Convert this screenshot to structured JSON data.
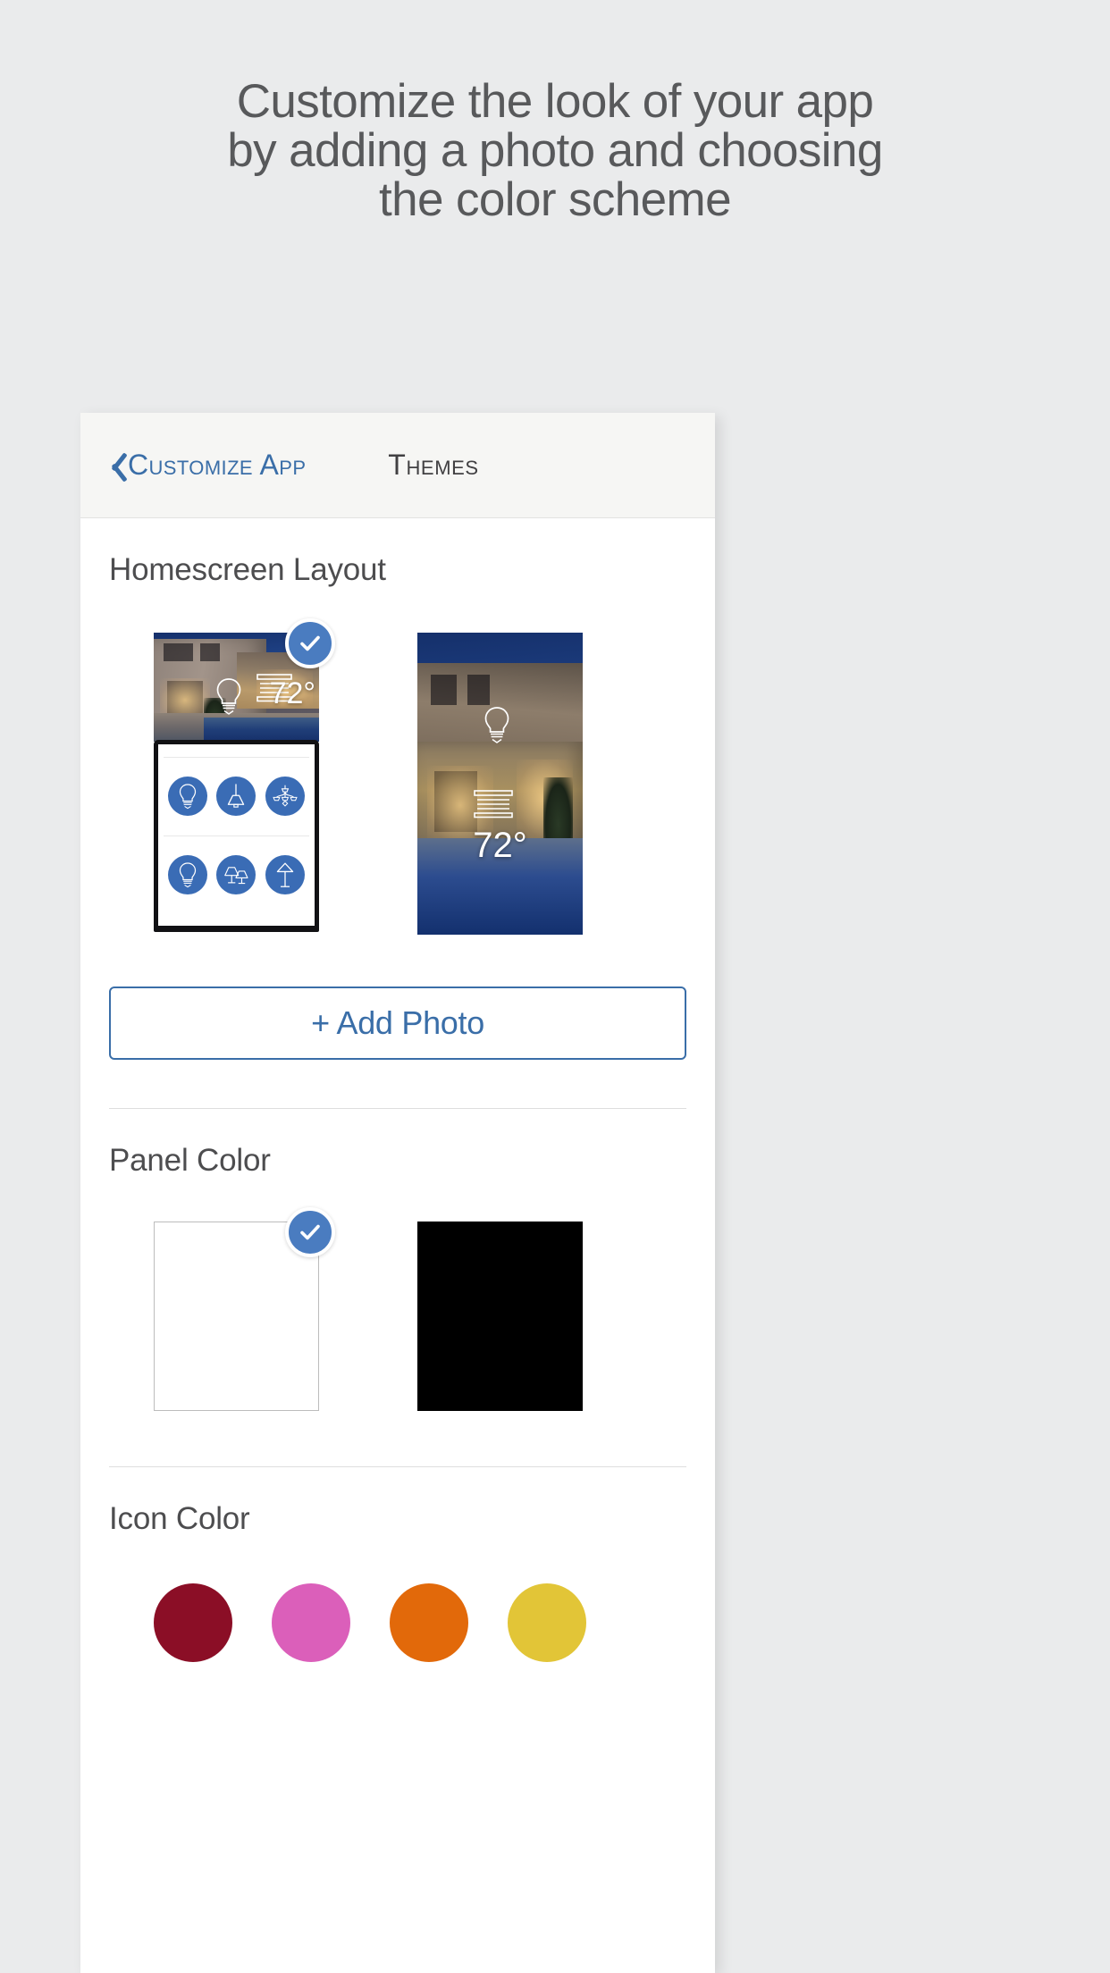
{
  "promo": {
    "lines": [
      "Customize the look of your app",
      "by adding a photo and choosing",
      "the color scheme"
    ]
  },
  "navbar": {
    "back_label": "Customize App",
    "back_icon": "chevron-left-icon",
    "title": "Themes"
  },
  "sections": {
    "homescreen": {
      "title": "Homescreen Layout",
      "options": [
        {
          "id": "layout-split",
          "selected": true,
          "badge_icon": "check-icon",
          "temperature": "72°",
          "overlay_icons": [
            "lightbulb-icon",
            "blinds-icon"
          ],
          "phone_icons": [
            "lightbulb-icon",
            "pendant-lamp-icon",
            "chandelier-icon",
            "lightbulb-icon",
            "table-lamps-icon",
            "floor-lamp-icon"
          ]
        },
        {
          "id": "layout-full-photo",
          "selected": false,
          "temperature": "72°",
          "overlay_icons": [
            "lightbulb-icon",
            "blinds-icon"
          ]
        }
      ],
      "add_photo_label": "+ Add Photo"
    },
    "panel_color": {
      "title": "Panel Color",
      "swatches": [
        {
          "id": "panel-white",
          "color": "#FFFFFF",
          "selected": true,
          "badge_icon": "check-icon"
        },
        {
          "id": "panel-black",
          "color": "#000000",
          "selected": false
        }
      ]
    },
    "icon_color": {
      "title": "Icon Color",
      "swatches": [
        {
          "id": "icon-color-crimson",
          "color": "#8B0E26"
        },
        {
          "id": "icon-color-pink",
          "color": "#DB5FBA"
        },
        {
          "id": "icon-color-orange",
          "color": "#E2690A"
        },
        {
          "id": "icon-color-yellow",
          "color": "#E2C537"
        }
      ]
    }
  },
  "theme": {
    "accent_blue": "#3A6EA8",
    "badge_blue": "#4A7CC0",
    "icon_circle_blue": "#3A6CB5",
    "page_bg": "#EAEBEC",
    "text_gray": "#58595B"
  }
}
